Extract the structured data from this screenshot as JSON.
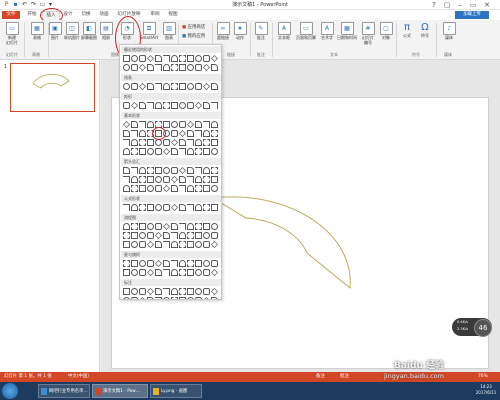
{
  "titlebar": {
    "title": "演示文稿1 - PowerPoint",
    "quick_icons": [
      "save-icon",
      "undo-icon",
      "redo-icon",
      "present-icon",
      "customize-icon"
    ],
    "window_buttons": [
      "?",
      "▢",
      "–",
      "▭",
      "✕"
    ]
  },
  "tabs": [
    {
      "label": "文件"
    },
    {
      "label": "开始"
    },
    {
      "label": "插入"
    },
    {
      "label": "设计"
    },
    {
      "label": "切换"
    },
    {
      "label": "动画"
    },
    {
      "label": "幻灯片放映"
    },
    {
      "label": "审阅"
    },
    {
      "label": "视图"
    }
  ],
  "share_label": "加载上传",
  "ribbon": {
    "buttons": [
      {
        "label": "新建\n幻灯片",
        "icon": "new-slide-icon"
      },
      {
        "label": "表格",
        "icon": "table-icon"
      },
      {
        "label": "图片",
        "icon": "picture-icon"
      },
      {
        "label": "联机图片",
        "icon": "online-picture-icon"
      },
      {
        "label": "屏幕截图",
        "icon": "screenshot-icon"
      },
      {
        "label": "相册",
        "icon": "album-icon"
      },
      {
        "label": "形状",
        "icon": "shapes-icon"
      },
      {
        "label": "SmartArt",
        "icon": "smartart-icon"
      },
      {
        "label": "图表",
        "icon": "chart-icon"
      },
      {
        "label": "应用商店",
        "icon": "store-icon"
      },
      {
        "label": "我的应用",
        "icon": "my-apps-icon"
      },
      {
        "label": "超链接",
        "icon": "hyperlink-icon"
      },
      {
        "label": "动作",
        "icon": "action-icon"
      },
      {
        "label": "批注",
        "icon": "comment-icon"
      },
      {
        "label": "文本框",
        "icon": "textbox-icon"
      },
      {
        "label": "页眉和页脚",
        "icon": "header-footer-icon"
      },
      {
        "label": "艺术字",
        "icon": "wordart-icon"
      },
      {
        "label": "日期和时间",
        "icon": "datetime-icon"
      },
      {
        "label": "幻灯片\n编号",
        "icon": "slide-number-icon"
      },
      {
        "label": "对象",
        "icon": "object-icon"
      },
      {
        "label": "公式",
        "icon": "equation-icon"
      },
      {
        "label": "符号",
        "icon": "symbol-icon"
      },
      {
        "label": "媒体",
        "icon": "media-icon"
      }
    ],
    "groups": [
      "幻灯片",
      "表格",
      "图像",
      "应用程序",
      "链接",
      "批注",
      "文本",
      "符号",
      "媒体"
    ]
  },
  "shapes_panel": {
    "sections": [
      {
        "title": "最近使用的形状",
        "rows": 2
      },
      {
        "title": "线条",
        "rows": 1
      },
      {
        "title": "矩形",
        "rows": 1
      },
      {
        "title": "基本形状",
        "rows": 4
      },
      {
        "title": "箭头总汇",
        "rows": 3
      },
      {
        "title": "公式形状",
        "rows": 1
      },
      {
        "title": "流程图",
        "rows": 3
      },
      {
        "title": "星与旗帜",
        "rows": 2
      },
      {
        "title": "标注",
        "rows": 2
      },
      {
        "title": "动作按钮",
        "rows": 1
      }
    ]
  },
  "slide_panel": {
    "slide_number": "1"
  },
  "statusbar": {
    "slide_info": "幻灯片 第 1 张，共 1 张",
    "language": "中文(中国)",
    "notes": "备注",
    "comments": "批注",
    "zoom": "76%"
  },
  "taskbar": {
    "items": [
      {
        "label": "网吧行业专用名单…",
        "icon": "ie-icon"
      },
      {
        "label": "演示文稿1 - Pow…",
        "icon": "powerpoint-icon"
      },
      {
        "label": "Ly.png - 画图",
        "icon": "paint-icon"
      }
    ],
    "time": "14:23",
    "date": "2017/6/11"
  },
  "meter": {
    "up": "0.4K/s",
    "down": "2.3K/s",
    "value": "46"
  },
  "watermark": {
    "line1": "Baidu 经验",
    "line2": "jingyan.baidu.com"
  },
  "colors": {
    "accent": "#d24726",
    "share": "#2b74c2",
    "arc": "#b8a24a",
    "highlight": "#d91e1e"
  }
}
